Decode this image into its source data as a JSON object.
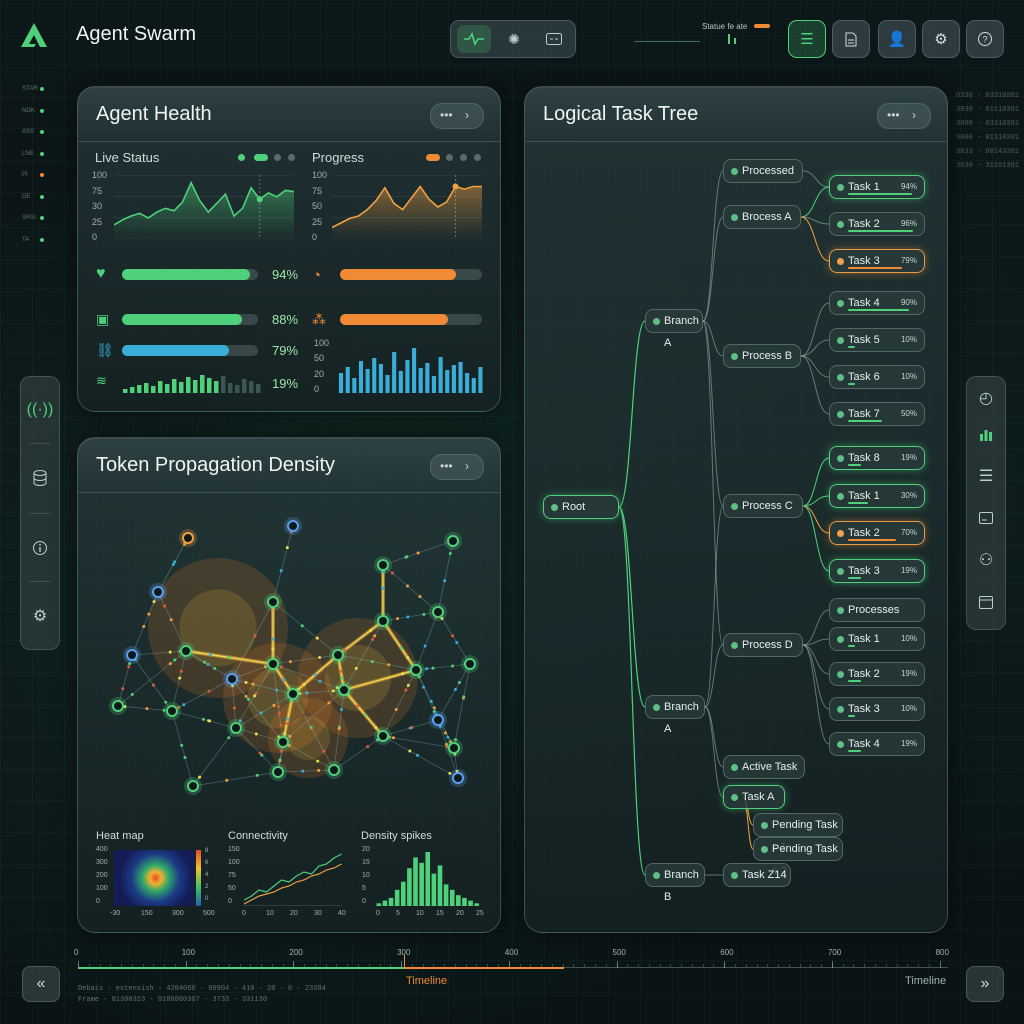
{
  "app": {
    "title": "Agent Swarm",
    "status_label": "Statue fe ate"
  },
  "left_ticks": [
    "STAR",
    "NGK",
    "ASS",
    "LNE",
    "PI",
    "DE",
    "SRSI",
    "TA"
  ],
  "right_codes": [
    "0330 - 03310001",
    "3930 - 01110301",
    "3000 - 03310301",
    "3000 - 01310301",
    "3033 - 00143301",
    "3030 - 31101301"
  ],
  "agent_health": {
    "title": "Agent Health",
    "live_status": "Live Status",
    "progress": "Progress",
    "y_ticks": [
      "100",
      "75",
      "30",
      "25",
      "0"
    ],
    "y_ticks2": [
      "100",
      "75",
      "50",
      "25",
      "0"
    ],
    "bar_y_ticks": [
      "100",
      "50",
      "20",
      "0"
    ],
    "metrics": [
      {
        "value": 0.94,
        "label": "94%",
        "color": "#4fd07a"
      },
      {
        "value": 0.88,
        "label": "88%",
        "color": "#4fd07a"
      },
      {
        "value": 0.79,
        "label": "79%",
        "color": "#3aaed8"
      },
      {
        "value": 0.19,
        "label": "19%",
        "color": "#4fd07a"
      }
    ],
    "progress_bars": [
      {
        "value": 0.82,
        "color": "#f08a35"
      },
      {
        "value": 0.76,
        "color": "#f08a35"
      }
    ],
    "live_series": [
      22,
      30,
      36,
      40,
      33,
      42,
      48,
      44,
      58,
      88,
      60,
      42,
      56,
      70,
      36,
      48,
      80,
      62,
      72,
      66,
      76,
      74
    ],
    "progress_series": [
      18,
      25,
      32,
      36,
      46,
      60,
      80,
      56,
      46,
      64,
      82,
      62,
      50,
      58,
      82,
      78,
      82,
      82
    ],
    "bars": [
      40,
      52,
      30,
      64,
      48,
      70,
      58,
      36,
      82,
      44,
      66,
      90,
      50,
      60,
      34,
      72,
      46,
      56,
      62,
      40,
      30,
      52
    ],
    "spark": [
      4,
      6,
      8,
      10,
      7,
      12,
      9,
      14,
      11,
      16,
      13,
      18,
      15,
      12,
      17,
      10,
      8,
      14,
      12,
      9
    ]
  },
  "token": {
    "title": "Token Propagation Density",
    "heat_title": "Heat map",
    "heat_y": [
      "400",
      "300",
      "200",
      "100",
      "0"
    ],
    "heat_x": [
      "-30",
      "150",
      "300",
      "500"
    ],
    "heat_scale": [
      "8",
      "6",
      "4",
      "2",
      "0"
    ],
    "conn_title": "Connectivity",
    "conn_y": [
      "150",
      "100",
      "75",
      "50",
      "0"
    ],
    "conn_x": [
      "0",
      "10",
      "20",
      "30",
      "40"
    ],
    "density_title": "Density spikes",
    "density_y": [
      "20",
      "15",
      "10",
      "5",
      "0"
    ],
    "density_x": [
      "0",
      "5",
      "10",
      "15",
      "20",
      "25"
    ],
    "density_bars": [
      1,
      2,
      3,
      6,
      9,
      14,
      18,
      16,
      20,
      12,
      15,
      8,
      6,
      4,
      3,
      2,
      1
    ]
  },
  "tree": {
    "title": "Logical Task Tree",
    "nodes": {
      "root": "Root",
      "branch_a": "Branch A",
      "branch_a2": "Branch A",
      "branch_b": "Branch B",
      "processed": "Processed",
      "brocess_a": "Brocess A",
      "process_b": "Process B",
      "process_c": "Process C",
      "process_d": "Process D",
      "active_task": "Active Task",
      "task_a": "Task A",
      "pending1": "Pending Task s 1",
      "pending2": "Pending Task s 2",
      "task_z14": "Task Z14",
      "processes": "Processes"
    },
    "tasks": [
      {
        "label": "Task 1",
        "pct": "94%",
        "style": "green"
      },
      {
        "label": "Task 2",
        "pct": "96%",
        "style": ""
      },
      {
        "label": "Task 3",
        "pct": "79%",
        "style": "orange"
      },
      {
        "label": "Task 4",
        "pct": "90%",
        "style": ""
      },
      {
        "label": "Task 5",
        "pct": "10%",
        "style": ""
      },
      {
        "label": "Task 6",
        "pct": "10%",
        "style": ""
      },
      {
        "label": "Task 7",
        "pct": "50%",
        "style": ""
      },
      {
        "label": "Task 8",
        "pct": "19%",
        "style": "green"
      },
      {
        "label": "Task 1",
        "pct": "30%",
        "style": "green"
      },
      {
        "label": "Task 2",
        "pct": "70%",
        "style": "orange"
      },
      {
        "label": "Task 3",
        "pct": "19%",
        "style": "green"
      },
      {
        "label": "Task 1",
        "pct": "10%",
        "style": ""
      },
      {
        "label": "Task 2",
        "pct": "19%",
        "style": ""
      },
      {
        "label": "Task 3",
        "pct": "10%",
        "style": ""
      },
      {
        "label": "Task 4",
        "pct": "19%",
        "style": ""
      }
    ]
  },
  "timeline": {
    "label_center": "Timeline",
    "label_right": "Timeline",
    "ticks": [
      "0",
      "100",
      "200",
      "300",
      "400",
      "500",
      "600",
      "700",
      "800"
    ],
    "code1": "Debais - extensish - 4204060 - 80904 - 410 - 20 - 0 - 23384",
    "code2": "Frame - 81300313 - 0180000307 - 3733 - 331130"
  },
  "colors": {
    "accent_green": "#4fd07a",
    "accent_orange": "#f08a35",
    "accent_blue": "#3aaed8"
  }
}
